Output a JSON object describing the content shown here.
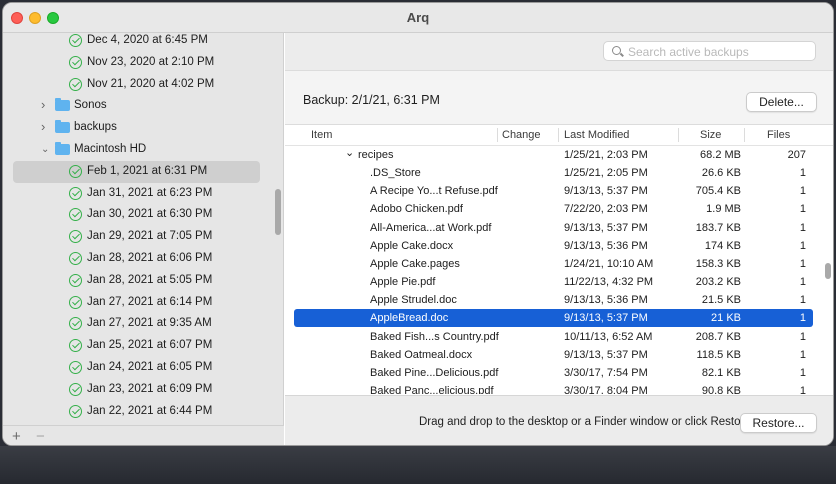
{
  "window": {
    "title": "Arq"
  },
  "sidebar": {
    "rows": [
      {
        "type": "backup",
        "label": "Dec 4, 2020 at 6:45 PM",
        "indent": 2
      },
      {
        "type": "backup",
        "label": "Nov 23, 2020 at 2:10 PM",
        "indent": 2
      },
      {
        "type": "backup",
        "label": "Nov 21, 2020 at 4:02 PM",
        "indent": 2
      },
      {
        "type": "folder",
        "label": "Sonos",
        "expanded": false
      },
      {
        "type": "folder",
        "label": "backups",
        "expanded": false
      },
      {
        "type": "folder",
        "label": "Macintosh HD",
        "expanded": true
      },
      {
        "type": "backup",
        "label": "Feb 1, 2021 at 6:31 PM",
        "selected": true
      },
      {
        "type": "backup",
        "label": "Jan 31, 2021 at 6:23 PM"
      },
      {
        "type": "backup",
        "label": "Jan 30, 2021 at 6:30 PM"
      },
      {
        "type": "backup",
        "label": "Jan 29, 2021 at 7:05 PM"
      },
      {
        "type": "backup",
        "label": "Jan 28, 2021 at 6:06 PM"
      },
      {
        "type": "backup",
        "label": "Jan 28, 2021 at 5:05 PM"
      },
      {
        "type": "backup",
        "label": "Jan 27, 2021 at 6:14 PM"
      },
      {
        "type": "backup",
        "label": "Jan 27, 2021 at 9:35 AM"
      },
      {
        "type": "backup",
        "label": "Jan 25, 2021 at 6:07 PM"
      },
      {
        "type": "backup",
        "label": "Jan 24, 2021 at 6:05 PM"
      },
      {
        "type": "backup",
        "label": "Jan 23, 2021 at 6:09 PM"
      },
      {
        "type": "backup",
        "label": "Jan 22, 2021 at 6:44 PM"
      }
    ],
    "add_label": "+",
    "remove_label": "−"
  },
  "search": {
    "placeholder": "Search active backups"
  },
  "backup": {
    "title": "Backup: 2/1/21, 6:31 PM",
    "delete_label": "Delete..."
  },
  "table": {
    "columns": {
      "item": "Item",
      "change": "Change",
      "modified": "Last Modified",
      "size": "Size",
      "files": "Files"
    },
    "rows": [
      {
        "item": "recipes",
        "folder": true,
        "modified": "1/25/21, 2:03 PM",
        "size": "68.2 MB",
        "files": "207"
      },
      {
        "item": ".DS_Store",
        "modified": "1/25/21, 2:05 PM",
        "size": "26.6 KB",
        "files": "1"
      },
      {
        "item": "A Recipe Yo...t Refuse.pdf",
        "modified": "9/13/13, 5:37 PM",
        "size": "705.4 KB",
        "files": "1"
      },
      {
        "item": "Adobo Chicken.pdf",
        "modified": "7/22/20, 2:03 PM",
        "size": "1.9 MB",
        "files": "1"
      },
      {
        "item": "All-America...at Work.pdf",
        "modified": "9/13/13, 5:37 PM",
        "size": "183.7 KB",
        "files": "1"
      },
      {
        "item": "Apple Cake.docx",
        "modified": "9/13/13, 5:36 PM",
        "size": "174 KB",
        "files": "1"
      },
      {
        "item": "Apple Cake.pages",
        "modified": "1/24/21, 10:10 AM",
        "size": "158.3 KB",
        "files": "1"
      },
      {
        "item": "Apple Pie.pdf",
        "modified": "11/22/13, 4:32 PM",
        "size": "203.2 KB",
        "files": "1"
      },
      {
        "item": "Apple Strudel.doc",
        "modified": "9/13/13, 5:36 PM",
        "size": "21.5 KB",
        "files": "1"
      },
      {
        "item": "AppleBread.doc",
        "modified": "9/13/13, 5:37 PM",
        "size": "21 KB",
        "files": "1",
        "selected": true
      },
      {
        "item": "Baked Fish...s Country.pdf",
        "modified": "10/11/13, 6:52 AM",
        "size": "208.7 KB",
        "files": "1"
      },
      {
        "item": "Baked Oatmeal.docx",
        "modified": "9/13/13, 5:37 PM",
        "size": "118.5 KB",
        "files": "1"
      },
      {
        "item": "Baked Pine...Delicious.pdf",
        "modified": "3/30/17, 7:54 PM",
        "size": "82.1 KB",
        "files": "1"
      },
      {
        "item": "Baked Panc...elicious.pdf",
        "modified": "3/30/17, 8:04 PM",
        "size": "90.8 KB",
        "files": "1"
      }
    ]
  },
  "footer": {
    "hint": "Drag and drop to the desktop or a Finder window or click Restore:",
    "restore_label": "Restore..."
  },
  "colors": {
    "selection": "#1760d6",
    "check": "#35b04a",
    "folder": "#5fb3ef"
  }
}
